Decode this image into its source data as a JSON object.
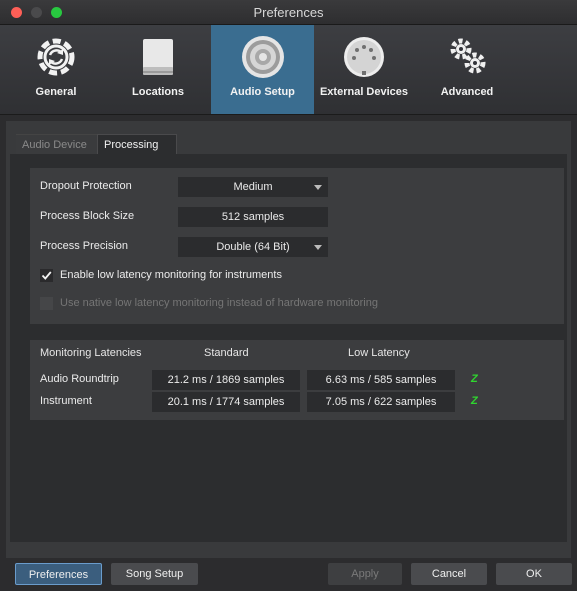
{
  "window": {
    "title": "Preferences"
  },
  "toolbar": {
    "items": [
      {
        "label": "General",
        "icon": "general-gear-cycle-icon"
      },
      {
        "label": "Locations",
        "icon": "drive-icon"
      },
      {
        "label": "Audio Setup",
        "icon": "speaker-icon",
        "active": true
      },
      {
        "label": "External Devices",
        "icon": "midi-connector-icon"
      },
      {
        "label": "Advanced",
        "icon": "gears-icon"
      }
    ]
  },
  "tabs": {
    "audio_device": "Audio Device",
    "processing": "Processing"
  },
  "processing": {
    "dropout_label": "Dropout Protection",
    "dropout_value": "Medium",
    "block_label": "Process Block Size",
    "block_value": "512 samples",
    "precision_label": "Process Precision",
    "precision_value": "Double (64 Bit)",
    "low_latency_label": "Enable low latency monitoring for instruments",
    "low_latency_checked": true,
    "native_label": "Use native low latency monitoring instead of hardware monitoring",
    "native_checked": false
  },
  "latencies": {
    "header_label": "Monitoring Latencies",
    "col_standard": "Standard",
    "col_low": "Low Latency",
    "rows": [
      {
        "label": "Audio Roundtrip",
        "standard": "21.2 ms / 1869 samples",
        "low": "6.63 ms / 585 samples",
        "z": "Z"
      },
      {
        "label": "Instrument",
        "standard": "20.1 ms / 1774 samples",
        "low": "7.05 ms / 622 samples",
        "z": "Z"
      }
    ]
  },
  "footer": {
    "preferences": "Preferences",
    "song_setup": "Song Setup",
    "apply": "Apply",
    "cancel": "Cancel",
    "ok": "OK"
  },
  "colors": {
    "accent": "#3a6d90",
    "z_indicator": "#2fd62f"
  }
}
